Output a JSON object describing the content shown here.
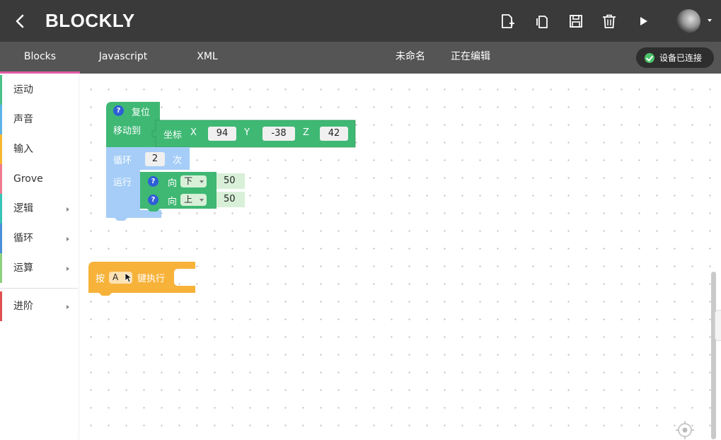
{
  "header": {
    "title": "BLOCKLY",
    "icons": [
      "back-icon",
      "new-file-icon",
      "copy-icon",
      "save-icon",
      "trash-icon",
      "play-icon"
    ]
  },
  "tabs": [
    {
      "label": "Blocks",
      "active": true
    },
    {
      "label": "Javascript",
      "active": false
    },
    {
      "label": "XML",
      "active": false
    }
  ],
  "toolbar": {
    "project_name": "未命名",
    "edit_status": "正在编辑",
    "device_status": "设备已连接"
  },
  "sidebar": {
    "categories": [
      {
        "label": "运动",
        "color": "#4cc08a",
        "has_submenu": false
      },
      {
        "label": "声音",
        "color": "#5db3e8",
        "has_submenu": false
      },
      {
        "label": "输入",
        "color": "#f7b731",
        "has_submenu": false
      },
      {
        "label": "Grove",
        "color": "#f07b8e",
        "has_submenu": false
      },
      {
        "label": "逻辑",
        "color": "#36c4b6",
        "has_submenu": true
      },
      {
        "label": "循环",
        "color": "#4a8fd9",
        "has_submenu": true
      },
      {
        "label": "运算",
        "color": "#8dd17d",
        "has_submenu": true
      },
      {
        "label": "进阶",
        "color": "#e05050",
        "has_submenu": true
      }
    ]
  },
  "blocks": {
    "reset": {
      "label": "复位"
    },
    "move_to": {
      "label": "移动到"
    },
    "coordinate": {
      "label": "坐标",
      "x_label": "X",
      "x": "94",
      "y_label": "Y",
      "y": "-38",
      "z_label": "Z",
      "z": "42"
    },
    "loop": {
      "label": "循环",
      "count": "2",
      "suffix": "次",
      "run_label": "运行"
    },
    "move_down": {
      "label": "向",
      "direction": "下",
      "amount": "50"
    },
    "move_up": {
      "label": "向",
      "direction": "上",
      "amount": "50"
    },
    "key_exec": {
      "prefix": "按",
      "key": "A",
      "suffix": "键执行"
    }
  },
  "colors": {
    "motion": "#3fb874",
    "loop": "#a5cdf7",
    "event": "#f7b23a",
    "topbar": "#3a3a3a",
    "tabbar": "#555555",
    "tab_accent": "#e05aa5"
  }
}
